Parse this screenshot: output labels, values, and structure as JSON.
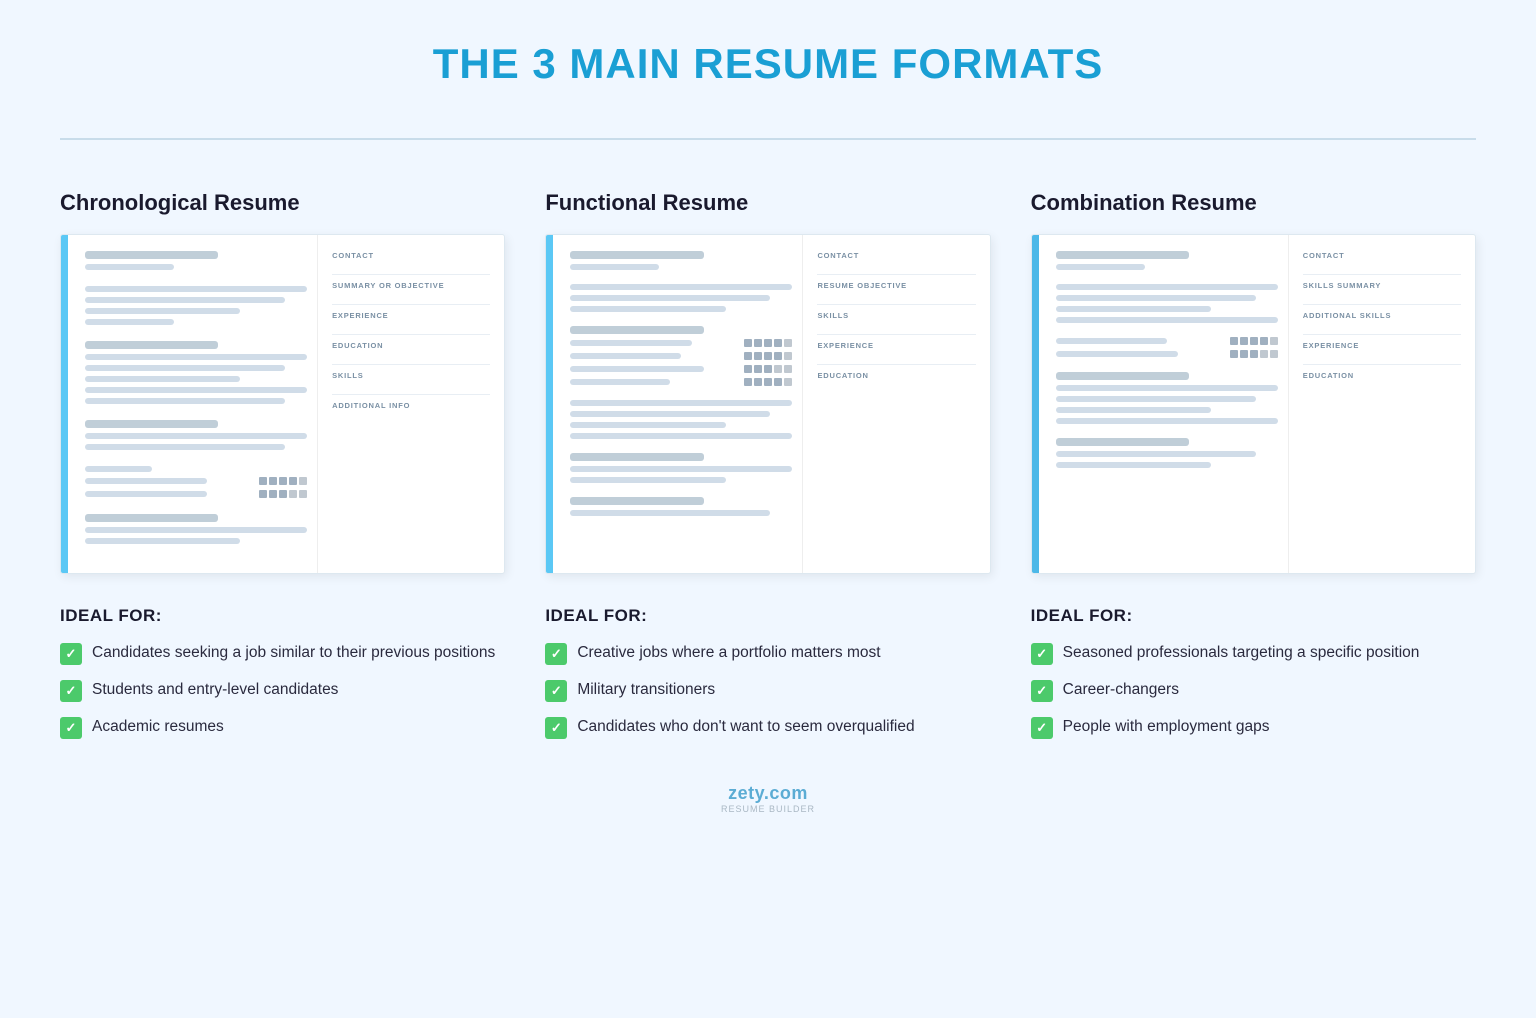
{
  "title": "THE 3 MAIN RESUME FORMATS",
  "columns": [
    {
      "id": "chronological",
      "title": "Chronological Resume",
      "resume": {
        "sections_right": [
          "CONTACT",
          "SUMMARY OR OBJECTIVE",
          "EXPERIENCE",
          "EDUCATION",
          "SKILLS",
          "ADDITIONAL INFO"
        ]
      },
      "ideal_for_label": "IDEAL FOR:",
      "items": [
        "Candidates seeking a job similar to their previous positions",
        "Students and entry-level candidates",
        "Academic resumes"
      ]
    },
    {
      "id": "functional",
      "title": "Functional Resume",
      "resume": {
        "sections_right": [
          "CONTACT",
          "RESUME OBJECTIVE",
          "SKILLS",
          "EXPERIENCE",
          "EDUCATION"
        ]
      },
      "ideal_for_label": "IDEAL FOR:",
      "items": [
        "Creative jobs where a portfolio matters most",
        "Military transitioners",
        "Candidates who don't want to seem overqualified"
      ]
    },
    {
      "id": "combination",
      "title": "Combination Resume",
      "resume": {
        "sections_right": [
          "CONTACT",
          "SKILLS SUMMARY",
          "ADDITIONAL SKILLS",
          "EXPERIENCE",
          "EDUCATION"
        ]
      },
      "ideal_for_label": "IDEAL FOR:",
      "items": [
        "Seasoned professionals targeting a specific position",
        "Career-changers",
        "People with employment gaps"
      ]
    }
  ],
  "footer": {
    "brand": "zety.com",
    "tagline": "RESUME BUILDER"
  }
}
